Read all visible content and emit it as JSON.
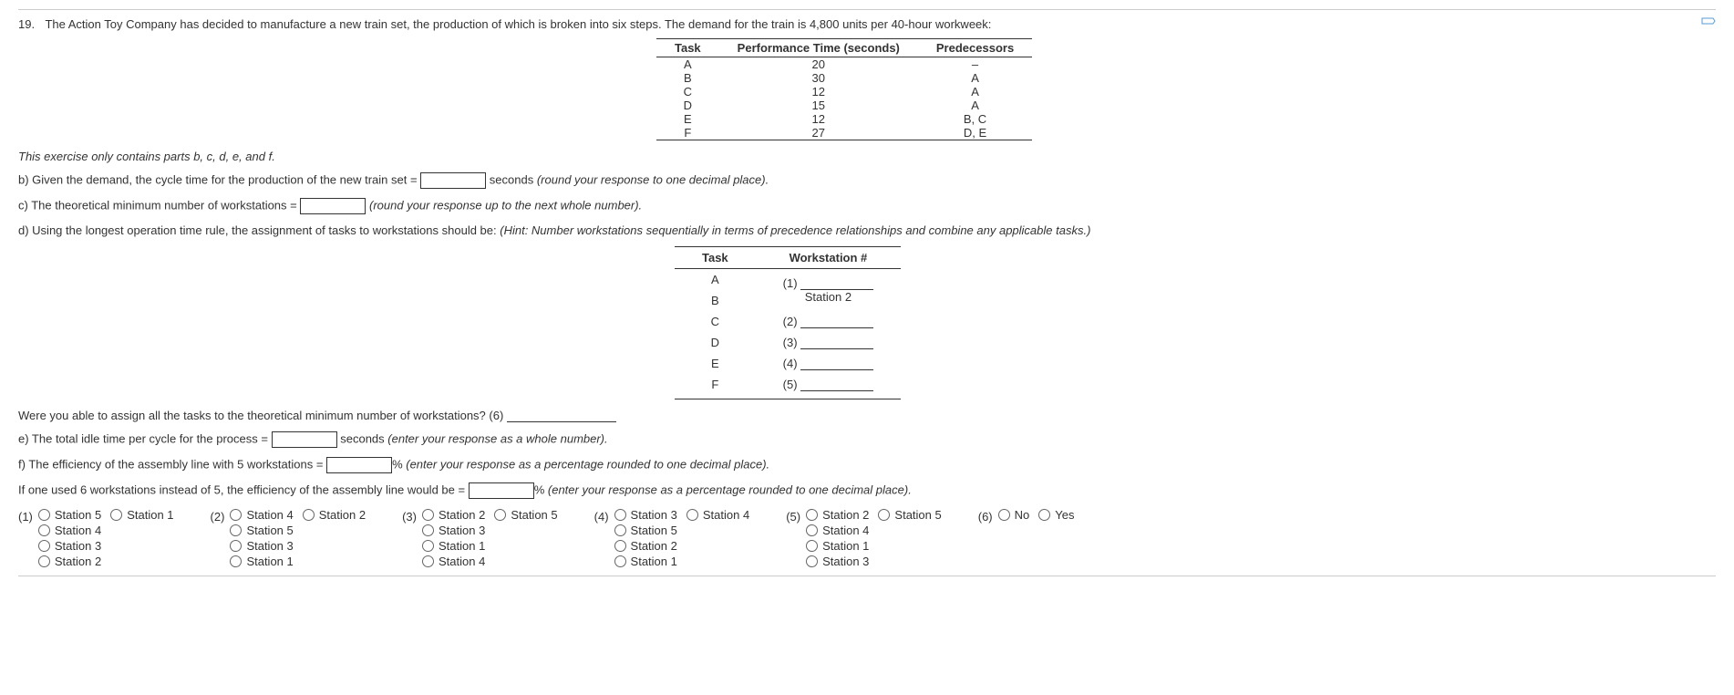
{
  "question": {
    "number": "19.",
    "text": "The Action Toy Company has decided to manufacture a new train set, the production of which is broken into six steps. The demand for the train is 4,800 units per 40-hour workweek:"
  },
  "table1": {
    "headers": [
      "Task",
      "Performance Time (seconds)",
      "Predecessors"
    ],
    "rows": [
      {
        "task": "A",
        "time": "20",
        "pred": "–"
      },
      {
        "task": "B",
        "time": "30",
        "pred": "A"
      },
      {
        "task": "C",
        "time": "12",
        "pred": "A"
      },
      {
        "task": "D",
        "time": "15",
        "pred": "A"
      },
      {
        "task": "E",
        "time": "12",
        "pred": "B, C"
      },
      {
        "task": "F",
        "time": "27",
        "pred": "D, E"
      }
    ]
  },
  "note": "This exercise only contains parts b, c, d, e, and f.",
  "parts": {
    "b_pre": "b) Given the demand, the cycle time for the production of the new train set =",
    "b_post": "seconds",
    "b_hint": "(round your response to one decimal place).",
    "c_pre": "c) The theoretical minimum number of workstations =",
    "c_hint": "(round your response up to the next whole number).",
    "d_pre": "d) Using the longest operation time rule, the assignment of tasks to workstations should be:",
    "d_hint": "(Hint: Number workstations sequentially in terms of precedence relationships and combine any applicable tasks.)"
  },
  "table2": {
    "headers": [
      "Task",
      "Workstation #"
    ],
    "rows": [
      {
        "task": "A",
        "label": "(1)",
        "val": ""
      },
      {
        "task": "B",
        "label": "",
        "val": "Station 2"
      },
      {
        "task": "C",
        "label": "(2)",
        "val": ""
      },
      {
        "task": "D",
        "label": "(3)",
        "val": ""
      },
      {
        "task": "E",
        "label": "(4)",
        "val": ""
      },
      {
        "task": "F",
        "label": "(5)",
        "val": ""
      }
    ]
  },
  "q6": "Were you able to assign all the tasks to the theoretical minimum number of workstations?  (6)",
  "parts2": {
    "e_pre": "e) The total idle time per cycle for the process =",
    "e_post": "seconds",
    "e_hint": "(enter your response as a whole number).",
    "f_pre": "f) The efficiency of the assembly line with 5 workstations =",
    "f_post": "%",
    "f_hint": "(enter your response as a percentage rounded to one decimal place).",
    "g_pre": "If one used 6 workstations instead of 5, the efficiency of the assembly line would be =",
    "g_post": "%",
    "g_hint": "(enter your response as a percentage rounded to one decimal place)."
  },
  "options": {
    "1": {
      "col1": [
        "Station 5",
        "Station 4",
        "Station 3",
        "Station 2"
      ],
      "col2": [
        "Station 1"
      ]
    },
    "2": {
      "col1": [
        "Station 4",
        "Station 5",
        "Station 3",
        "Station 1"
      ],
      "col2": [
        "Station 2"
      ]
    },
    "3": {
      "col1": [
        "Station 2",
        "Station 3",
        "Station 1",
        "Station 4"
      ],
      "col2": [
        "Station 5"
      ]
    },
    "4": {
      "col1": [
        "Station 3",
        "Station 5",
        "Station 2",
        "Station 1"
      ],
      "col2": [
        "Station 4"
      ]
    },
    "5": {
      "col1": [
        "Station 2",
        "Station 4",
        "Station 1",
        "Station 3"
      ],
      "col2": [
        "Station 5"
      ]
    },
    "6": {
      "col1": [
        "No"
      ],
      "col2": [
        "Yes"
      ]
    }
  },
  "optlabels": {
    "1": "(1)",
    "2": "(2)",
    "3": "(3)",
    "4": "(4)",
    "5": "(5)",
    "6": "(6)"
  }
}
